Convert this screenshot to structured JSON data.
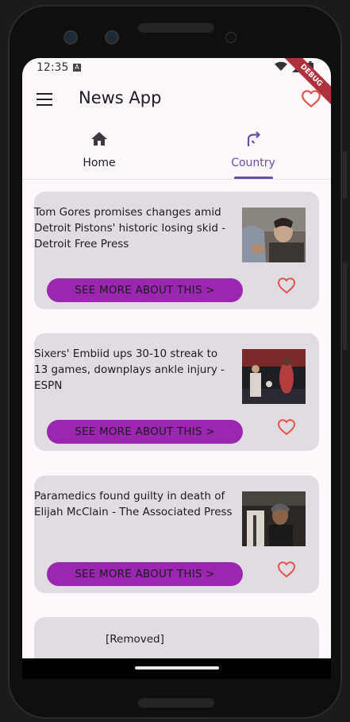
{
  "status": {
    "time": "12:35",
    "a_badge": "A",
    "debug": "DEBUG"
  },
  "appbar": {
    "title": "News App"
  },
  "tabs": [
    {
      "label": "Home",
      "icon": "home-icon"
    },
    {
      "label": "Country",
      "icon": "turn-arrow-icon"
    }
  ],
  "colors": {
    "accent": "#6750a4",
    "button": "#9b27b0",
    "heart": "#e0524a",
    "card": "#e0dce1"
  },
  "articles": [
    {
      "title": "Tom Gores promises changes amid Detroit Pistons' historic losing skid - Detroit Free Press",
      "button": "SEE MORE ABOUT THIS >"
    },
    {
      "title": "Sixers' Embiid ups 30-10 streak to 13 games, downplays ankle injury - ESPN",
      "button": "SEE MORE ABOUT THIS >"
    },
    {
      "title": "Paramedics found guilty in death of Elijah McClain - The Associated Press",
      "button": "SEE MORE ABOUT THIS >"
    },
    {
      "title": "[Removed]"
    }
  ]
}
